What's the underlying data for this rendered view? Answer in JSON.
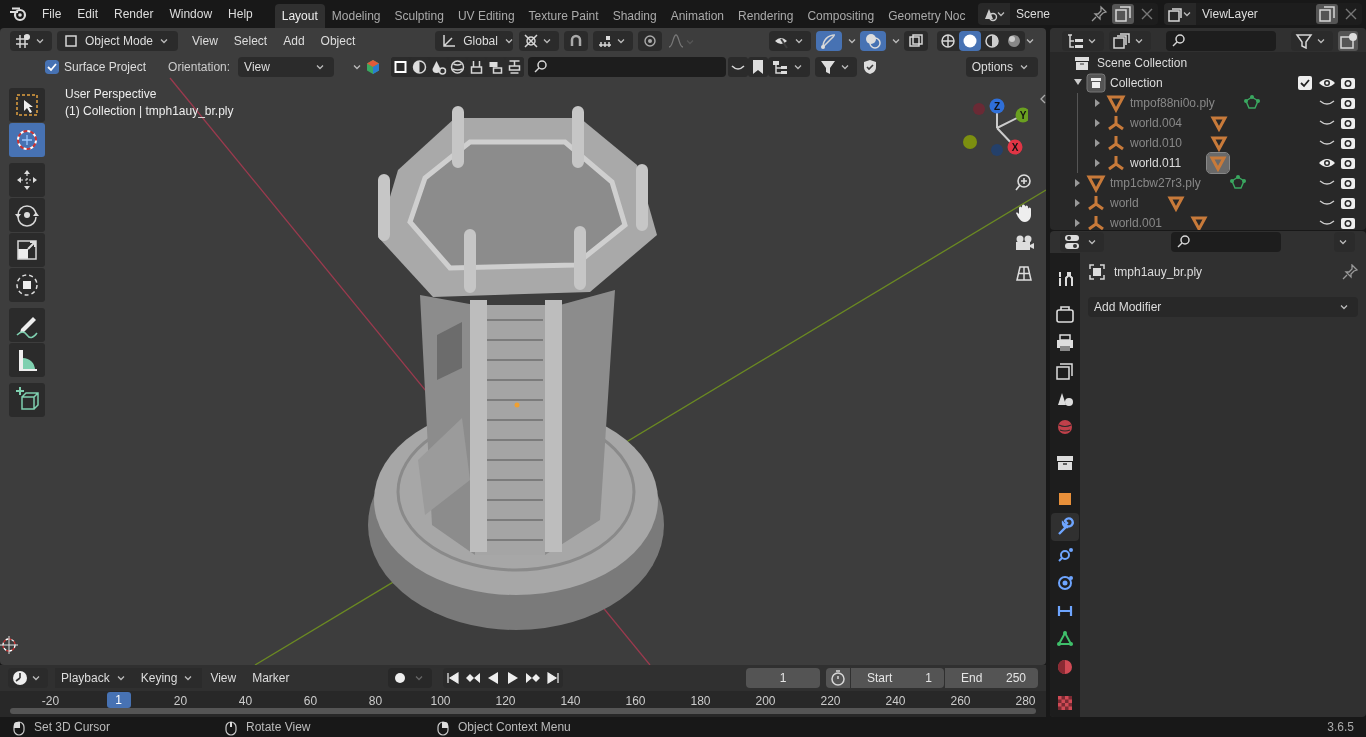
{
  "top_bar": {
    "menus": [
      "File",
      "Edit",
      "Render",
      "Window",
      "Help"
    ],
    "workspaces": [
      {
        "label": "Layout",
        "selected": true
      },
      {
        "label": "Modeling",
        "selected": false
      },
      {
        "label": "Sculpting",
        "selected": false
      },
      {
        "label": "UV Editing",
        "selected": false
      },
      {
        "label": "Texture Paint",
        "selected": false
      },
      {
        "label": "Shading",
        "selected": false
      },
      {
        "label": "Animation",
        "selected": false
      },
      {
        "label": "Rendering",
        "selected": false
      },
      {
        "label": "Compositing",
        "selected": false
      },
      {
        "label": "Geometry Noc",
        "selected": false
      }
    ],
    "scene": "Scene",
    "view_layer": "ViewLayer"
  },
  "viewport": {
    "header": {
      "mode": "Object Mode",
      "menus": [
        "View",
        "Select",
        "Add",
        "Object"
      ],
      "orientation": "Global",
      "gizmos_on": true,
      "overlays_on": true,
      "shading": [
        {
          "kind": "wireframe",
          "selected": false
        },
        {
          "kind": "solid",
          "selected": true
        },
        {
          "kind": "material",
          "selected": false
        },
        {
          "kind": "rendered",
          "selected": false
        }
      ]
    },
    "tool_header": {
      "surface_project": {
        "label": "Surface Project",
        "checked": true
      },
      "orientation_label": "Orientation:",
      "orientation": "View",
      "options": "Options"
    },
    "info": [
      "User Perspective",
      "(1) Collection | tmph1auy_br.ply"
    ],
    "tool_groups": [
      [
        {
          "kind": "select_box",
          "selected": false
        },
        {
          "kind": "cursor",
          "selected": true
        }
      ],
      [
        {
          "kind": "move",
          "selected": false
        },
        {
          "kind": "rotate",
          "selected": false
        },
        {
          "kind": "scale",
          "selected": false
        },
        {
          "kind": "transform",
          "selected": false
        }
      ],
      [
        {
          "kind": "annotate",
          "selected": false
        },
        {
          "kind": "measure",
          "selected": false
        }
      ],
      [
        {
          "kind": "add_cube",
          "selected": false
        }
      ]
    ],
    "axes": [
      "Z",
      "Y",
      "X"
    ]
  },
  "outliner": {
    "root": "Scene Collection",
    "items": [
      {
        "name": "Collection",
        "kind": "collection",
        "expanded": true,
        "checked": true,
        "visible": true,
        "children": [
          {
            "name": "tmpof88ni0o.ply",
            "kind": "mesh",
            "expanded": false,
            "visible": false,
            "selected": false
          },
          {
            "name": "world.004",
            "kind": "empty",
            "expanded": false,
            "visible": false,
            "selected": false
          },
          {
            "name": "world.010",
            "kind": "empty",
            "expanded": false,
            "visible": false,
            "selected": false
          },
          {
            "name": "world.011",
            "kind": "empty",
            "expanded": false,
            "visible": true,
            "selected": true
          }
        ]
      },
      {
        "name": "tmp1cbw27r3.ply",
        "kind": "mesh",
        "expanded": false,
        "visible": false,
        "selected": false
      },
      {
        "name": "world",
        "kind": "empty",
        "expanded": false,
        "visible": false,
        "selected": false
      },
      {
        "name": "world.001",
        "kind": "empty",
        "expanded": false,
        "visible": false,
        "selected": false
      }
    ]
  },
  "properties": {
    "tab_groups": [
      [
        {
          "kind": "tool",
          "selected": false
        }
      ],
      [
        {
          "kind": "render",
          "selected": false
        },
        {
          "kind": "output",
          "selected": false
        },
        {
          "kind": "view_layer",
          "selected": false
        },
        {
          "kind": "scene",
          "selected": false
        },
        {
          "kind": "world",
          "selected": false
        }
      ],
      [
        {
          "kind": "collection",
          "selected": false
        }
      ],
      [
        {
          "kind": "object",
          "selected": false
        },
        {
          "kind": "modifier",
          "selected": true
        },
        {
          "kind": "particles",
          "selected": false
        },
        {
          "kind": "physics",
          "selected": false
        },
        {
          "kind": "constraints",
          "selected": false
        },
        {
          "kind": "data",
          "selected": false
        },
        {
          "kind": "material",
          "selected": false
        }
      ],
      [
        {
          "kind": "texture",
          "selected": false
        }
      ]
    ],
    "object_name": "tmph1auy_br.ply",
    "add_modifier": "Add Modifier"
  },
  "timeline": {
    "menus": [
      {
        "label": "Playback",
        "kind": "dropdown"
      },
      {
        "label": "Keying",
        "kind": "dropdown"
      },
      {
        "label": "View",
        "kind": "menu"
      },
      {
        "label": "Marker",
        "kind": "menu"
      }
    ],
    "current_frame": "1",
    "start_label": "Start",
    "start": "1",
    "end_label": "End",
    "end": "250",
    "ruler_labels": [
      "-20",
      "20",
      "40",
      "60",
      "80",
      "100",
      "120",
      "140",
      "160",
      "180",
      "200",
      "220",
      "240",
      "260",
      "280"
    ],
    "ruler_current": "1"
  },
  "status_bar": {
    "hints": [
      {
        "text": "Set 3D Cursor",
        "kind": "left"
      },
      {
        "text": "Rotate View",
        "kind": "middle"
      },
      {
        "text": "Object Context Menu",
        "kind": "right"
      }
    ],
    "version": "3.6.5"
  }
}
